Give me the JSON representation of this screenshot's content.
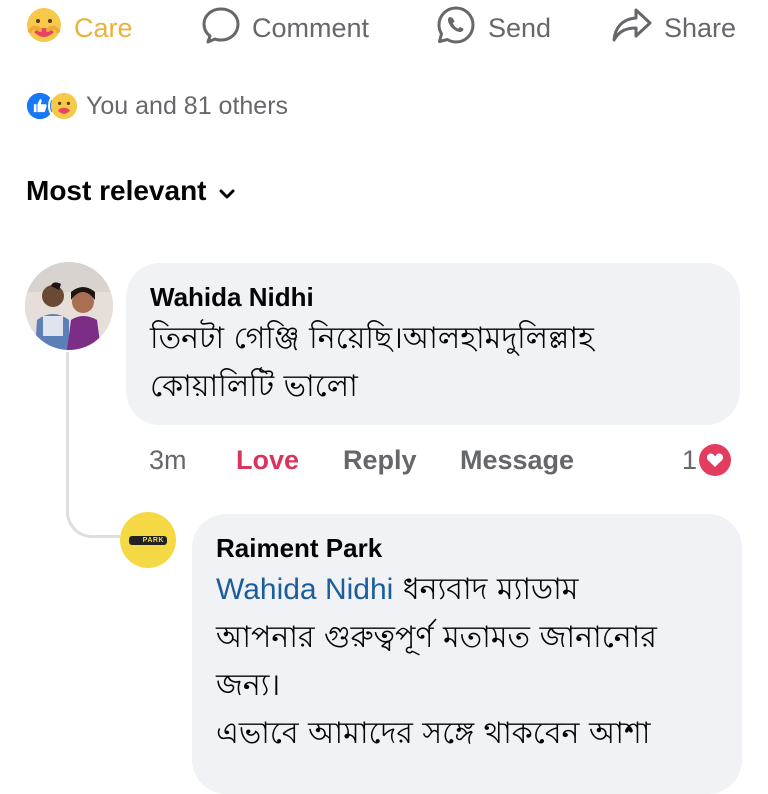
{
  "actions": {
    "care_label": "Care",
    "comment_label": "Comment",
    "send_label": "Send",
    "share_label": "Share"
  },
  "reactions": {
    "summary": "You and 81 others",
    "icons": [
      "like-reaction-icon",
      "care-reaction-icon"
    ]
  },
  "sort": {
    "label": "Most relevant"
  },
  "comment": {
    "author": "Wahida Nidhi",
    "lines": [
      "তিনটা গেঞ্জি নিয়েছি।আলহামদুলিল্লাহ",
      "কোয়ালিটি ভালো"
    ],
    "time": "3m",
    "love_label": "Love",
    "reply_label": "Reply",
    "message_label": "Message",
    "reaction_count": "1"
  },
  "reply": {
    "author": "Raiment Park",
    "mention": "Wahida Nidhi",
    "line1_rest": " ধন্যবাদ ম্যাডাম",
    "lines": [
      "আপনার গুরুত্বপূর্ণ মতামত জানানোর",
      "জন্য।",
      "এভাবে আমাদের সঙ্গে থাকবেন আশা"
    ],
    "avatar_logo_text": "PARK"
  },
  "colors": {
    "care_accent": "#e9b23f",
    "love_accent": "#d9345c",
    "like_blue": "#1877f2",
    "mention_blue": "#1b5e9b",
    "bubble_bg": "#f0f2f5",
    "avatar_yellow": "#f5d944"
  }
}
